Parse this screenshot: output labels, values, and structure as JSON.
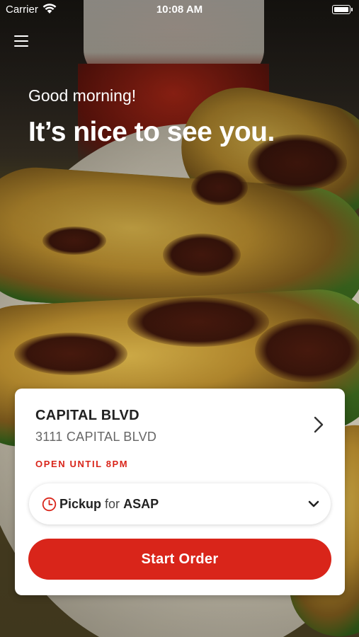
{
  "status_bar": {
    "carrier": "Carrier",
    "time": "10:08 AM"
  },
  "header": {
    "menu_icon": "hamburger-menu-icon",
    "greeting": "Good morning!",
    "headline": "It’s nice to see you."
  },
  "store_card": {
    "store_name": "CAPITAL BLVD",
    "store_address": "3111 CAPITAL BLVD",
    "open_status": "OPEN UNTIL 8PM",
    "order_mode": {
      "mode": "Pickup",
      "conjunction": "for",
      "time": "ASAP"
    },
    "start_button_label": "Start Order"
  },
  "colors": {
    "accent": "#d9251a",
    "card_background": "#ffffff",
    "text_primary": "#222222",
    "text_secondary": "#666666"
  }
}
